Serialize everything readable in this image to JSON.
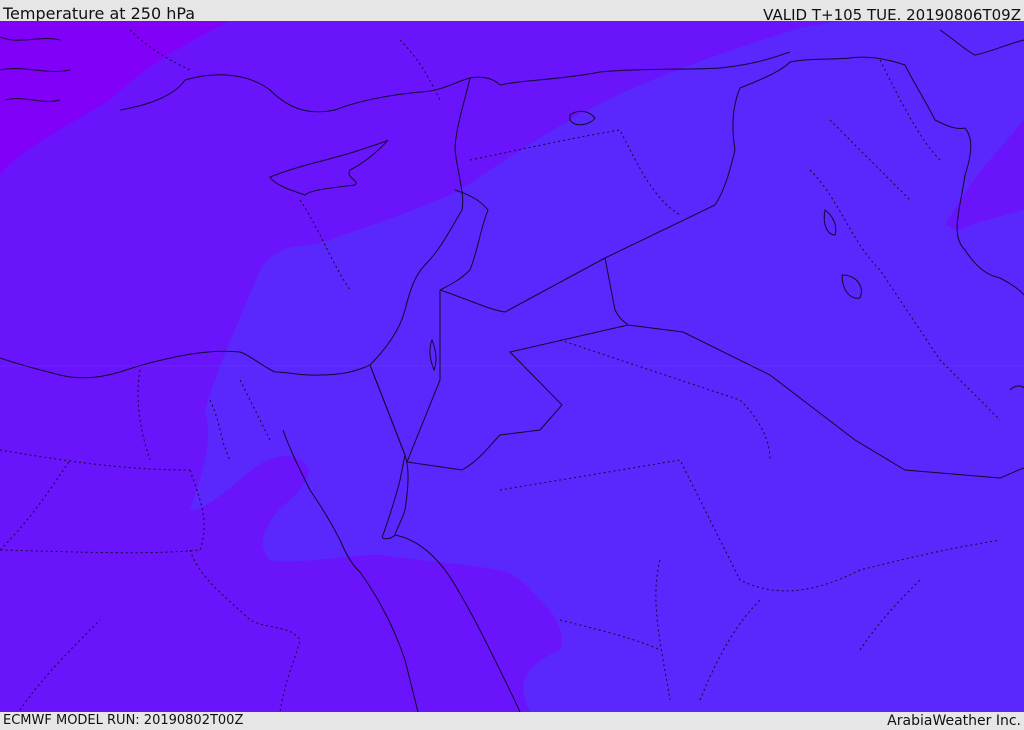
{
  "header": {
    "title": "Temperature at 250 hPa",
    "valid": "VALID T+105 TUE. 20190806T09Z"
  },
  "footer": {
    "model_run": "ECMWF MODEL RUN: 20190802T00Z",
    "credit": "ArabiaWeather Inc."
  },
  "colors": {
    "warm_band": "#5a28fc",
    "mid_band": "#6a14fc",
    "cold_band": "#7a08fc",
    "coldest_band": "#8800f8",
    "boundary": "#1a0a3a"
  }
}
